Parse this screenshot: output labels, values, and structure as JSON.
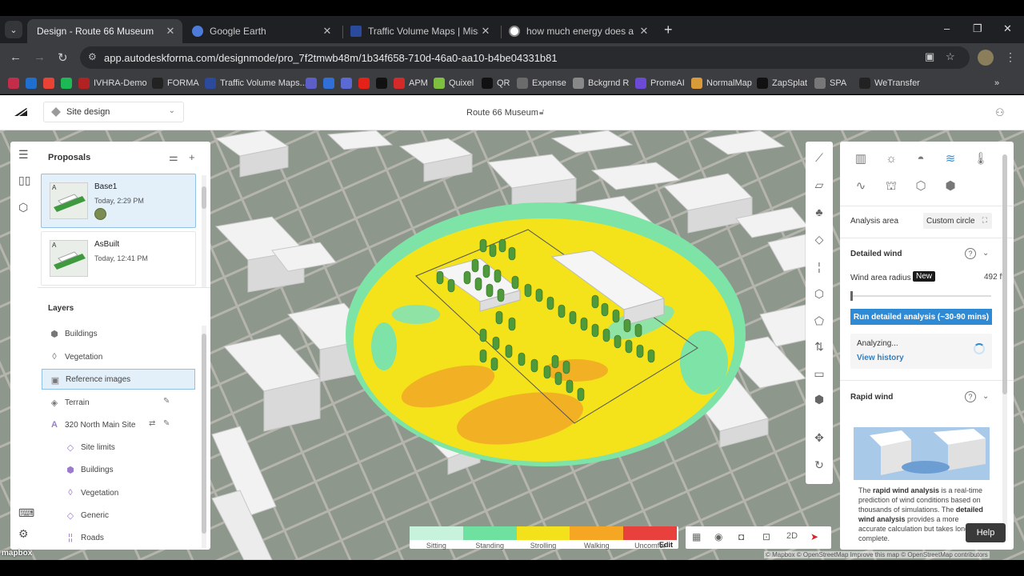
{
  "browser": {
    "tabs": [
      {
        "title": "Design - Route 66 Museum",
        "active": true,
        "favicon_color": "#3c3d41"
      },
      {
        "title": "Google Earth",
        "active": false,
        "favicon_color": "#4d7bd9"
      },
      {
        "title": "Traffic Volume Maps | Missouri",
        "active": false,
        "favicon_color": "#2b4a9b"
      },
      {
        "title": "how much energy does a buildi",
        "active": false,
        "favicon_color": "#ffffff"
      }
    ],
    "url": "app.autodeskforma.com/designmode/pro_7f2tmwb48m/1b34f658-710d-46a0-aa10-b4be04331b81",
    "bookmarks": [
      {
        "label": "",
        "color": "#c42d4a"
      },
      {
        "label": "",
        "color": "#1e6fd0"
      },
      {
        "label": "",
        "color": "#ea4335"
      },
      {
        "label": "",
        "color": "#1db954"
      },
      {
        "label": "IVHRA-Demo",
        "color": "#b22222"
      },
      {
        "label": "FORMA",
        "color": "#222222"
      },
      {
        "label": "Traffic Volume Maps...",
        "color": "#2b4a9b"
      },
      {
        "label": "",
        "color": "#5b5fc7"
      },
      {
        "label": "",
        "color": "#2f6fd6"
      },
      {
        "label": "",
        "color": "#5a6ad2"
      },
      {
        "label": "",
        "color": "#e62117"
      },
      {
        "label": "",
        "color": "#111111"
      },
      {
        "label": "APM",
        "color": "#d42a2a"
      },
      {
        "label": "Quixel",
        "color": "#7fbf3f"
      },
      {
        "label": "QR",
        "color": "#111111"
      },
      {
        "label": "Expense",
        "color": "#6b6b6b"
      },
      {
        "label": "Bckgrnd R",
        "color": "#888888"
      },
      {
        "label": "PromeAI",
        "color": "#6b4ad6"
      },
      {
        "label": "NormalMap",
        "color": "#d99a3a"
      },
      {
        "label": "ZapSplat",
        "color": "#111111"
      },
      {
        "label": "SPA",
        "color": "#777777"
      },
      {
        "label": "WeTransfer",
        "color": "#222222"
      }
    ]
  },
  "app": {
    "site_dropdown": "Site design",
    "project_title": "Route 66 Museum"
  },
  "proposals": {
    "title": "Proposals",
    "items": [
      {
        "name": "Base1",
        "time": "Today, 2:29 PM",
        "selected": true
      },
      {
        "name": "AsBuilt",
        "time": "Today, 12:41 PM",
        "selected": false
      }
    ]
  },
  "layers": {
    "title": "Layers",
    "items": [
      {
        "label": "Buildings",
        "icon": "cube-icon",
        "selected": false
      },
      {
        "label": "Vegetation",
        "icon": "leaf-icon",
        "selected": false
      },
      {
        "label": "Reference images",
        "icon": "image-icon",
        "selected": true
      },
      {
        "label": "Terrain",
        "icon": "terrain-icon",
        "selected": false
      },
      {
        "label": "320 North Main Site",
        "icon": "site-a-icon",
        "selected": false
      }
    ],
    "sub_items": [
      {
        "label": "Site limits",
        "icon": "diamond-icon"
      },
      {
        "label": "Buildings",
        "icon": "cube-icon"
      },
      {
        "label": "Vegetation",
        "icon": "leaf-icon"
      },
      {
        "label": "Generic",
        "icon": "diamond-icon"
      },
      {
        "label": "Roads",
        "icon": "road-icon"
      }
    ]
  },
  "analysis": {
    "area_label": "Analysis area",
    "area_value": "Custom circle",
    "detailed_title": "Detailed wind",
    "radius_label": "Wind area radius",
    "new_badge": "New",
    "radius_value": "492 ft",
    "slider_fraction": 0.0,
    "run_label": "Run detailed analysis (~30-90 mins)",
    "status": "Analyzing...",
    "view_history": "View history",
    "rapid_title": "Rapid wind",
    "rapid_desc_1": "The ",
    "rapid_desc_b1": "rapid wind analysis",
    "rapid_desc_2": " is a real-time prediction of wind conditions based on thousands of simulations. The ",
    "rapid_desc_b2": "detailed wind analysis",
    "rapid_desc_3": " provides a more accurate calculation but takes longer to complete."
  },
  "legend": {
    "items": [
      {
        "label": "Sitting",
        "color": "#c7f2dc"
      },
      {
        "label": "Standing",
        "color": "#6ee0a0"
      },
      {
        "label": "Strolling",
        "color": "#f3e21b"
      },
      {
        "label": "Walking",
        "color": "#f5a623"
      },
      {
        "label": "Uncomfor",
        "color": "#e8403c"
      }
    ],
    "edit": "Edit"
  },
  "toolbar": {
    "mode_2d": "2D"
  },
  "help_label": "Help",
  "mapbox_label": "mapbox",
  "attribution": "© Mapbox © OpenStreetMap Improve this map © OpenStreetMap contributors"
}
